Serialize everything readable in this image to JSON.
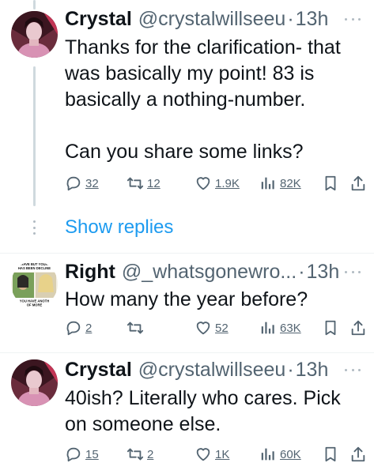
{
  "tweets": [
    {
      "name": "Crystal",
      "handle": "@crystalwillseeu",
      "time": "13h",
      "text": [
        "Thanks for the clarification- that was basically my point! 83 is basically a nothing-number.",
        "Can you share some links?"
      ],
      "replies": "32",
      "retweets": "12",
      "likes": "1.9K",
      "views": "82K"
    },
    {
      "name": "Right",
      "handle": "@_whatsgonewro...",
      "time": "13h",
      "text": [
        "How many the year before?"
      ],
      "replies": "2",
      "retweets": "",
      "likes": "52",
      "views": "63K"
    },
    {
      "name": "Crystal",
      "handle": "@crystalwillseeu",
      "time": "13h",
      "text": [
        "40ish? Literally who cares. Pick on someone else."
      ],
      "replies": "15",
      "retweets": "2",
      "likes": "1K",
      "views": "60K"
    }
  ],
  "show_replies_label": "Show replies",
  "separator": "·",
  "icons": {
    "reply": "reply-icon",
    "retweet": "retweet-icon",
    "like": "heart-icon",
    "views": "views-icon",
    "bookmark": "bookmark-icon",
    "share": "share-icon",
    "more": "more-icon"
  },
  "colors": {
    "link": "#1d9bf0",
    "text": "#0f1419",
    "muted": "#536471",
    "thread_line": "#cfd9de"
  },
  "avatar_text": [
    "HAVE BUT YOUR",
    "HAS BEEN DECLINE",
    "YOU HAVE ANOTH",
    "OF MORE"
  ]
}
